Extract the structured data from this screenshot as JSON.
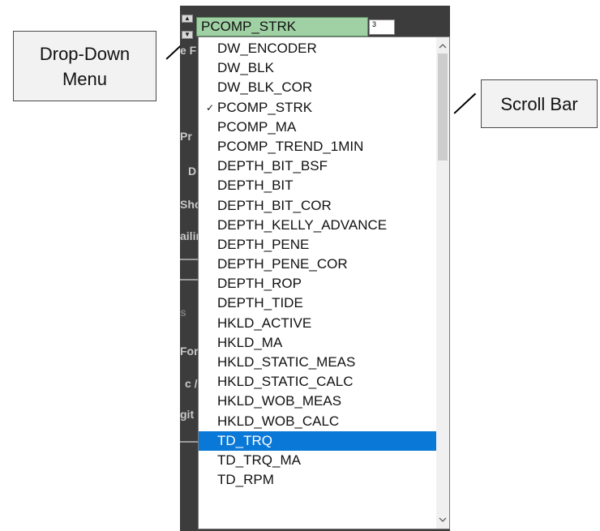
{
  "callouts": {
    "dropdown": "Drop-Down\nMenu",
    "scrollbar": "Scroll Bar"
  },
  "combo": {
    "value": "PCOMP_STRK",
    "count": "3"
  },
  "background_text": [
    "e F",
    "Pr",
    "D",
    "Sho",
    "ailir",
    "s",
    "For",
    "c /",
    "git"
  ],
  "dropdown": {
    "items": [
      {
        "label": "DW_ENCODER"
      },
      {
        "label": "DW_BLK"
      },
      {
        "label": "DW_BLK_COR"
      },
      {
        "label": "PCOMP_STRK",
        "checked": true
      },
      {
        "label": "PCOMP_MA"
      },
      {
        "label": "PCOMP_TREND_1MIN"
      },
      {
        "label": "DEPTH_BIT_BSF"
      },
      {
        "label": "DEPTH_BIT"
      },
      {
        "label": "DEPTH_BIT_COR"
      },
      {
        "label": "DEPTH_KELLY_ADVANCE"
      },
      {
        "label": "DEPTH_PENE"
      },
      {
        "label": "DEPTH_PENE_COR"
      },
      {
        "label": "DEPTH_ROP"
      },
      {
        "label": "DEPTH_TIDE"
      },
      {
        "label": "HKLD_ACTIVE"
      },
      {
        "label": "HKLD_MA"
      },
      {
        "label": "HKLD_STATIC_MEAS"
      },
      {
        "label": "HKLD_STATIC_CALC"
      },
      {
        "label": "HKLD_WOB_MEAS"
      },
      {
        "label": "HKLD_WOB_CALC"
      },
      {
        "label": "TD_TRQ",
        "highlighted": true
      },
      {
        "label": "TD_TRQ_MA"
      },
      {
        "label": "TD_RPM"
      }
    ],
    "check_glyph": "✓"
  },
  "scrollbar": {
    "up_icon": "chevron-up-icon",
    "down_icon": "chevron-down-icon",
    "scroll_position": 0.0
  },
  "colors": {
    "combo_fill": "#9fd1a4",
    "highlight": "#0a78d7",
    "app_background": "#3c3c3c"
  }
}
